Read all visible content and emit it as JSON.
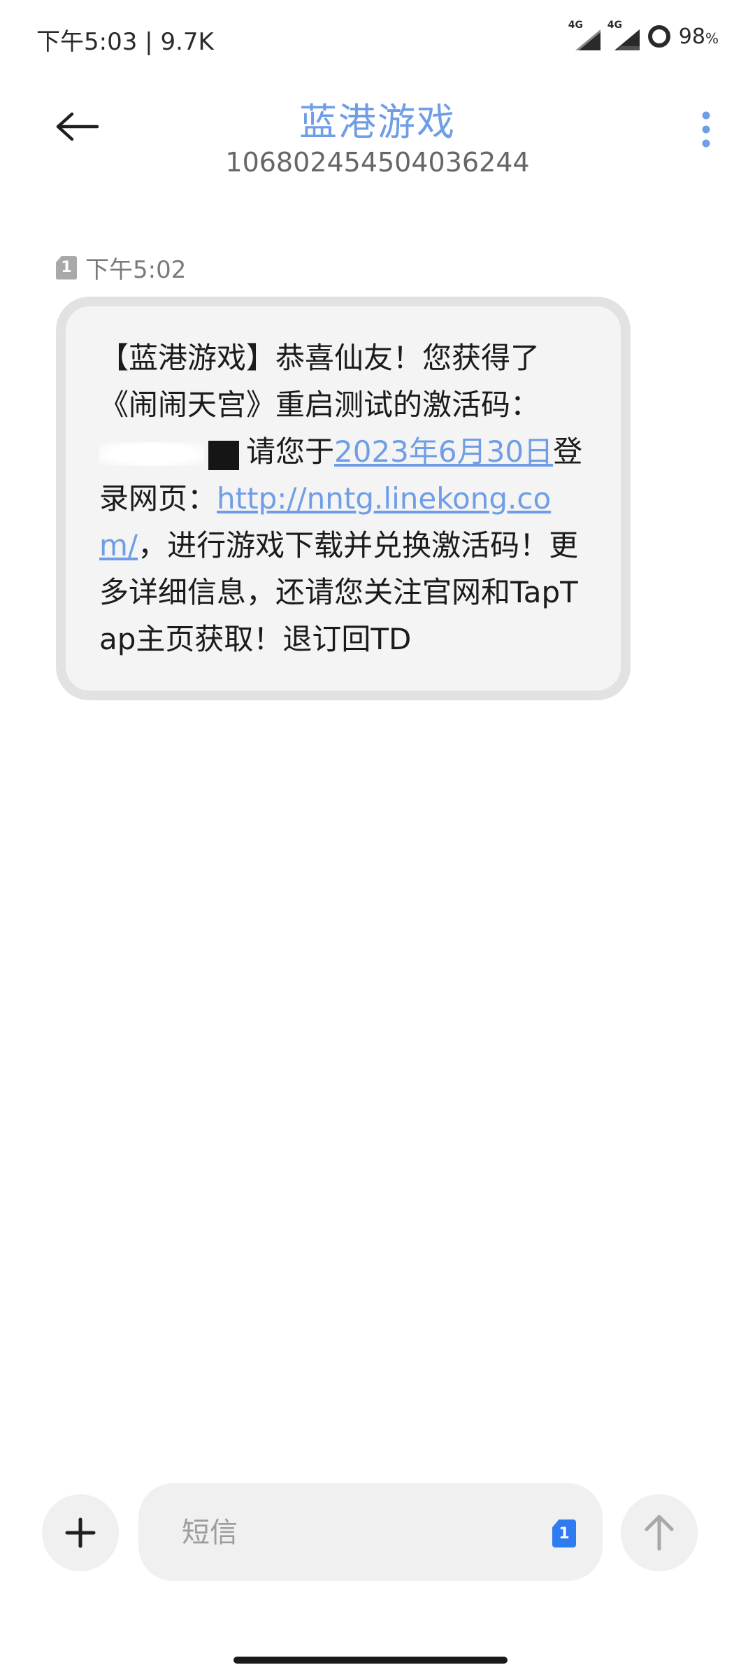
{
  "status_bar": {
    "time": "下午5:03",
    "separator": "|",
    "net_speed": "9.7K",
    "sim1_network": "4G",
    "sim2_network": "4G",
    "battery_percent": "98",
    "battery_unit": "%"
  },
  "header": {
    "contact_name": "蓝港游戏",
    "contact_number": "106802454504036244"
  },
  "message": {
    "sim_slot": "1",
    "timestamp": "下午5:02",
    "text_part1": "【蓝港游戏】恭喜仙友！您获得了《闹闹天宫》重启测试的激活码：",
    "text_part2": "请您于",
    "date_link": "2023年6月30日",
    "text_part3": "登录网页：",
    "url_link": "http://nntg.linekong.com/",
    "text_part4": "，进行游戏下载并兑换激活码！更多详细信息，还请您关注官网和TapTap主页获取！退订回TD"
  },
  "composer": {
    "placeholder": "短信",
    "sim_slot": "1"
  },
  "colors": {
    "accent": "#6f9ee6",
    "sim_blue": "#2f7bf0",
    "bubble_bg": "#f4f4f4",
    "bubble_border": "#e2e2e2"
  },
  "icons": {
    "back": "arrow-left-icon",
    "more": "more-vertical-icon",
    "plus": "plus-icon",
    "send": "arrow-up-icon"
  }
}
